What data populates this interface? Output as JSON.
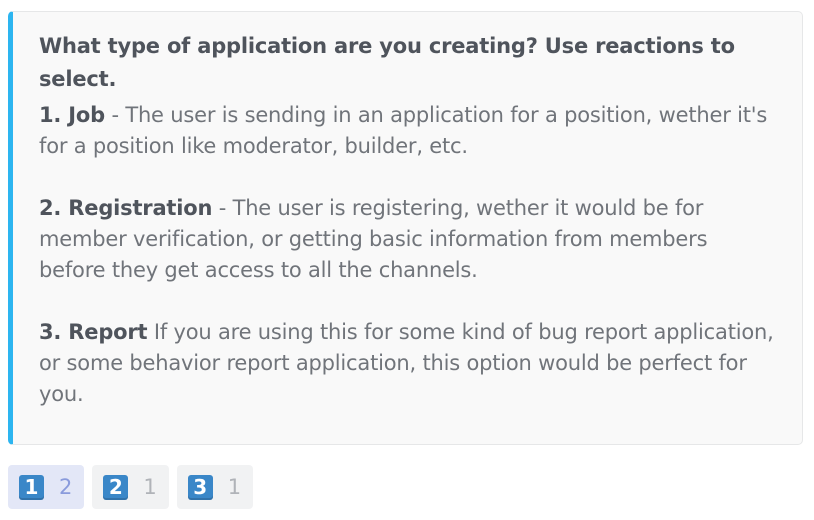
{
  "embed": {
    "accent_color": "#2db5f0",
    "title": "What type of application are you creating? Use reactions to select.",
    "options": [
      {
        "head": "1. Job",
        "text": " - The user is sending in an application for a position, wether it's for a position like moderator, builder, etc."
      },
      {
        "head": "2. Registration",
        "text": " - The user is registering, wether it would be for member verification, or getting basic information from members before they get access to all the channels."
      },
      {
        "head": "3. Report",
        "text": " If you are using this for some kind of bug report application, or some behavior report application, this option would be perfect for you."
      }
    ]
  },
  "reactions": [
    {
      "emoji": "1",
      "icon": "keycap-1-icon",
      "count": "2",
      "selected": true
    },
    {
      "emoji": "2",
      "icon": "keycap-2-icon",
      "count": "1",
      "selected": false
    },
    {
      "emoji": "3",
      "icon": "keycap-3-icon",
      "count": "1",
      "selected": false
    }
  ]
}
